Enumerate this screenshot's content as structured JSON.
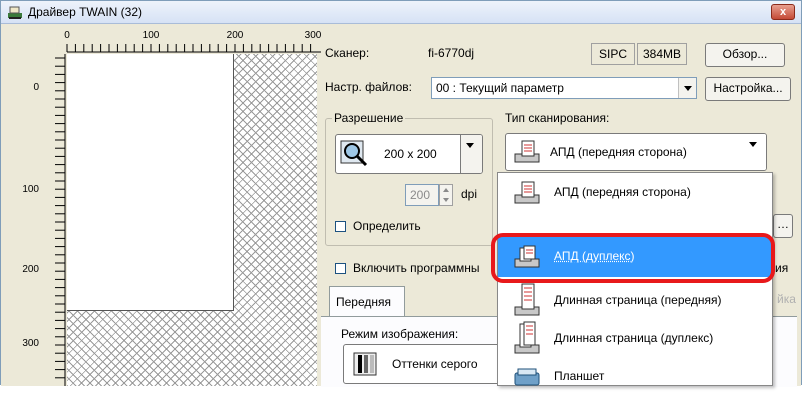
{
  "window": {
    "title": "Драйвер TWAIN (32)",
    "close_label": "x"
  },
  "ruler": {
    "top_ticks": [
      "0",
      "100",
      "200",
      "300"
    ],
    "left_ticks": [
      "0",
      "100",
      "200",
      "300"
    ]
  },
  "scanner": {
    "label": "Сканер:",
    "model": "fi-6770dj",
    "interface": "SIPC",
    "memory": "384MB",
    "browse_label": "Обзор..."
  },
  "file_settings": {
    "label": "Настр. файлов:",
    "value": "00 : Текущий параметр",
    "setup_label": "Настройка..."
  },
  "resolution": {
    "group_title": "Разрешение",
    "value": "200 x 200",
    "custom_value": "200",
    "unit": "dpi",
    "define_label": "Определить"
  },
  "scan_type": {
    "label": "Тип сканирования:",
    "selected": "АПД (передняя сторона)",
    "options": [
      "АПД (передняя сторона)",
      "АПД (дуплекс)",
      "Длинная страница (передняя)",
      "Длинная страница (дуплекс)",
      "Планшет"
    ],
    "highlighted_index": 1
  },
  "software": {
    "label": "Включить программны",
    "suffix": "ия"
  },
  "tabs": {
    "front": "Передняя",
    "back_partial": "йка"
  },
  "image_mode": {
    "label": "Режим изображения:",
    "value": "Оттенки серого"
  },
  "colors": {
    "highlight": "#e8191b",
    "selection": "#3399ff"
  }
}
